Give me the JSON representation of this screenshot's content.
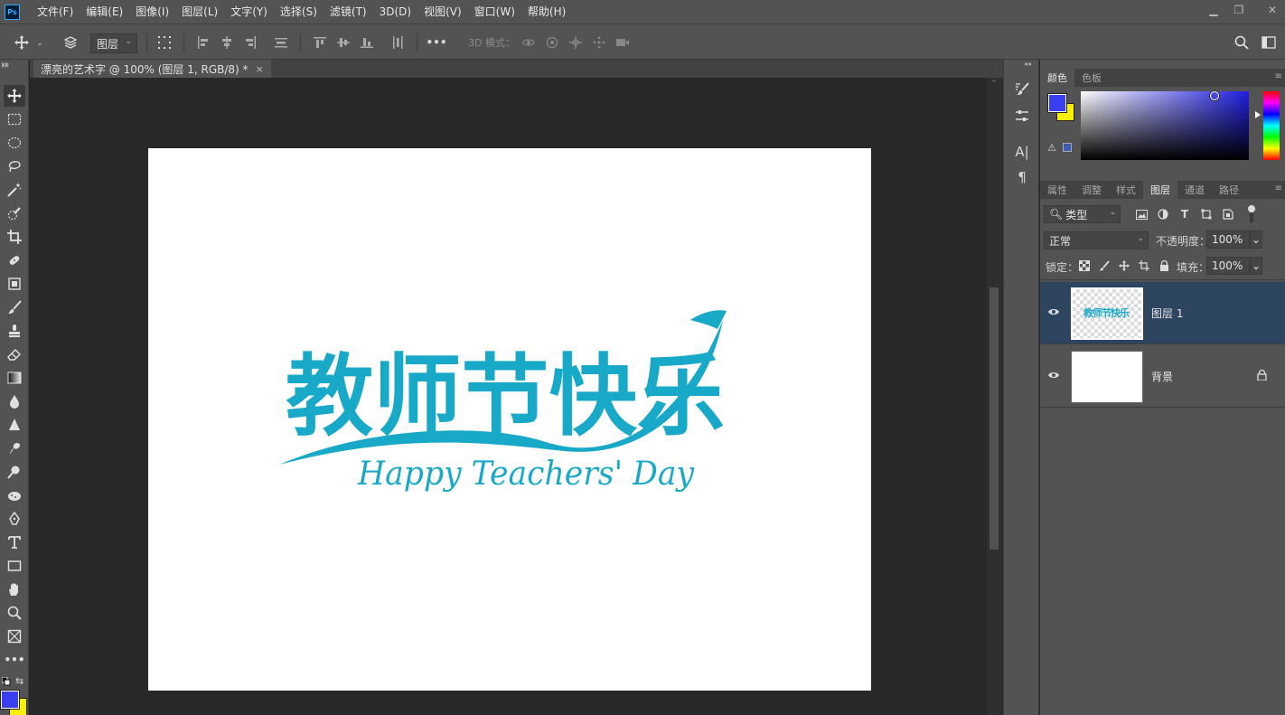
{
  "app": {
    "logo": "Ps"
  },
  "menu": [
    "文件(F)",
    "编辑(E)",
    "图像(I)",
    "图层(L)",
    "文字(Y)",
    "选择(S)",
    "滤镜(T)",
    "3D(D)",
    "视图(V)",
    "窗口(W)",
    "帮助(H)"
  ],
  "window_controls": {
    "minimize": "▁",
    "restore": "❐",
    "close": "✕"
  },
  "options_bar": {
    "auto_select_target": "图层",
    "three_d_mode_label": "3D 模式：",
    "more": "•••"
  },
  "document": {
    "tab_title": "漂亮的艺术字 @ 100% (图层 1, RGB/8) *",
    "close": "×",
    "artwork": {
      "headline": "教师节快乐",
      "subtitle": "Happy Teachers' Day",
      "color": "#19a9c8"
    }
  },
  "colors": {
    "foreground": "#3a3ff0",
    "background": "#f8f000",
    "accent": "#31a8ff"
  },
  "color_panel": {
    "tabs": [
      "颜色",
      "色板"
    ],
    "active_tab": "颜色"
  },
  "layers_panel": {
    "tabs": [
      "属性",
      "调整",
      "样式",
      "图层",
      "通道",
      "路径"
    ],
    "active_tab": "图层",
    "filter_kind": "类型",
    "blend_mode": "正常",
    "opacity_label": "不透明度：",
    "opacity_value": "100%",
    "lock_label": "锁定：",
    "fill_label": "填充：",
    "fill_value": "100%",
    "layers": [
      {
        "name": "图层 1",
        "selected": true,
        "visible": true,
        "thumb_text": "教师节快乐"
      },
      {
        "name": "背景",
        "selected": false,
        "visible": true,
        "locked": true
      }
    ]
  },
  "tools": [
    "move-tool",
    "rectangular-marquee-tool",
    "elliptical-marquee-tool",
    "lasso-tool",
    "magic-wand-tool",
    "quick-selection-tool",
    "crop-tool",
    "healing-brush-tool",
    "patch-tool",
    "brush-tool",
    "clone-stamp-tool",
    "eraser-tool",
    "gradient-tool",
    "blur-tool",
    "sharpen-tool",
    "smudge-tool",
    "dodge-tool",
    "sponge-tool",
    "pen-tool",
    "type-tool",
    "rectangle-tool",
    "hand-tool",
    "zoom-tool",
    "frame-tool",
    "more-tools"
  ]
}
